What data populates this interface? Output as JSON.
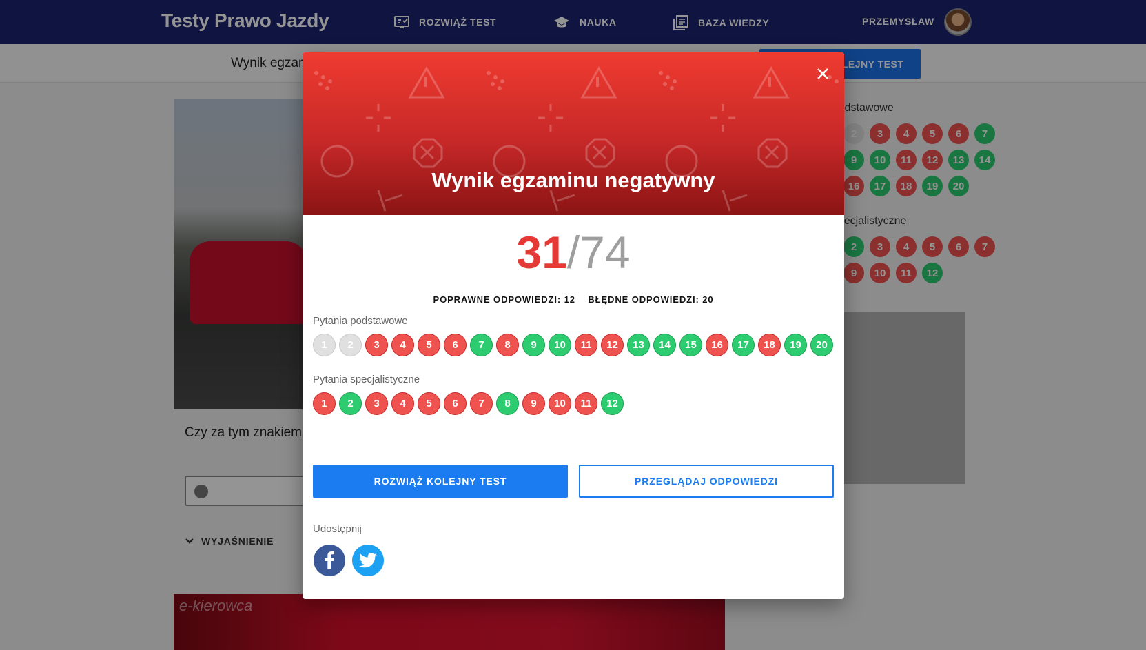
{
  "header": {
    "brand": "Testy Prawo Jazdy",
    "nav": [
      {
        "label": "ROZWIĄŻ TEST",
        "icon": "exam-icon"
      },
      {
        "label": "NAUKA",
        "icon": "graduation-cap-icon"
      },
      {
        "label": "BAZA WIEDZY",
        "icon": "library-icon"
      }
    ],
    "user": {
      "name": "PRZEMYSŁAW",
      "icon": "avatar"
    }
  },
  "subheader": {
    "title": "Wynik egzaminu",
    "button_label": "ROZWIĄŻ KOLEJNY TEST"
  },
  "question": {
    "text": "Czy za tym znakiem uprawnione pojazdy",
    "explanation_label": "WYJAŚNIENIE",
    "image_watermark": "e-kierowca"
  },
  "sidebar": {
    "basic_label": "Pytania podstawowe",
    "specialist_label": "Pytania specjalistyczne"
  },
  "modal": {
    "title": "Wynik egzaminu negatywny",
    "score": {
      "correct": "31",
      "separator": "/",
      "total": "74"
    },
    "stats": {
      "correct_label": "POPRAWNE ODPOWIEDZI: 12",
      "wrong_label": "BŁĘDNE ODPOWIEDZI: 20"
    },
    "basic": {
      "label": "Pytania podstawowe",
      "items": [
        {
          "n": "1",
          "status": "gray"
        },
        {
          "n": "2",
          "status": "gray"
        },
        {
          "n": "3",
          "status": "red"
        },
        {
          "n": "4",
          "status": "red"
        },
        {
          "n": "5",
          "status": "red"
        },
        {
          "n": "6",
          "status": "red"
        },
        {
          "n": "7",
          "status": "green"
        },
        {
          "n": "8",
          "status": "red"
        },
        {
          "n": "9",
          "status": "green"
        },
        {
          "n": "10",
          "status": "green"
        },
        {
          "n": "11",
          "status": "red"
        },
        {
          "n": "12",
          "status": "red"
        },
        {
          "n": "13",
          "status": "green"
        },
        {
          "n": "14",
          "status": "green"
        },
        {
          "n": "15",
          "status": "green"
        },
        {
          "n": "16",
          "status": "red"
        },
        {
          "n": "17",
          "status": "green"
        },
        {
          "n": "18",
          "status": "red"
        },
        {
          "n": "19",
          "status": "green"
        },
        {
          "n": "20",
          "status": "green"
        }
      ]
    },
    "specialist": {
      "label": "Pytania specjalistyczne",
      "items": [
        {
          "n": "1",
          "status": "red"
        },
        {
          "n": "2",
          "status": "green"
        },
        {
          "n": "3",
          "status": "red"
        },
        {
          "n": "4",
          "status": "red"
        },
        {
          "n": "5",
          "status": "red"
        },
        {
          "n": "6",
          "status": "red"
        },
        {
          "n": "7",
          "status": "red"
        },
        {
          "n": "8",
          "status": "green"
        },
        {
          "n": "9",
          "status": "red"
        },
        {
          "n": "10",
          "status": "red"
        },
        {
          "n": "11",
          "status": "red"
        },
        {
          "n": "12",
          "status": "green"
        }
      ]
    },
    "primary_button": "ROZWIĄŻ KOLEJNY TEST",
    "secondary_button": "PRZEGLĄDAJ ODPOWIEDZI",
    "share_label": "Udostępnij",
    "share_icons": [
      "facebook-icon",
      "twitter-icon"
    ],
    "close_icon": "close-icon"
  },
  "colors": {
    "brand_bar": "#1d2470",
    "accent": "#1a7cf0",
    "fail": "#e53935",
    "correct": "#2ecc71",
    "wrong": "#ef5350"
  }
}
